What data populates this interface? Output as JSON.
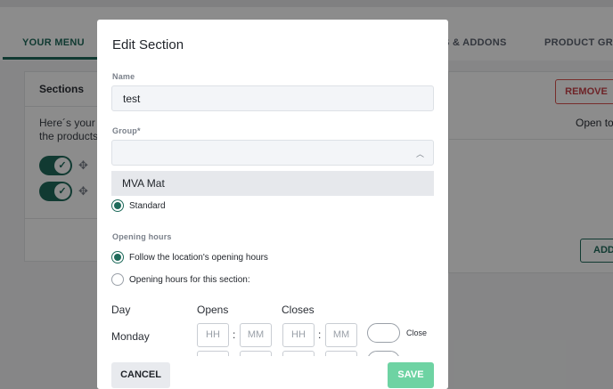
{
  "tabs": [
    {
      "label": "YOUR MENU"
    },
    {
      "label": "S & ADDONS"
    },
    {
      "label": "PRODUCT GROU"
    }
  ],
  "background": {
    "sections_title": "Sections",
    "desc_line1": "Here´s your l",
    "desc_line2": "the products",
    "remove_label": "REMOVE",
    "open_to_label": "Open to",
    "add_label": "ADD"
  },
  "modal": {
    "title": "Edit Section",
    "name_label": "Name",
    "name_value": "test",
    "group_label": "Group*",
    "group_option": "MVA Mat",
    "standard_label": "Standard",
    "opening_hours_label": "Opening hours",
    "follow_label": "Follow the location's opening hours",
    "custom_label": "Opening hours for this section:",
    "day_header": "Day",
    "opens_header": "Opens",
    "closes_header": "Closes",
    "day_monday": "Monday",
    "hh_placeholder": "HH",
    "mm_placeholder": "MM",
    "close_label": "Close",
    "cancel_label": "CANCEL",
    "save_label": "SAVE"
  },
  "colors": {
    "accent": "#1f6b5b",
    "save": "#6ed3a3",
    "remove": "#c8434a"
  }
}
